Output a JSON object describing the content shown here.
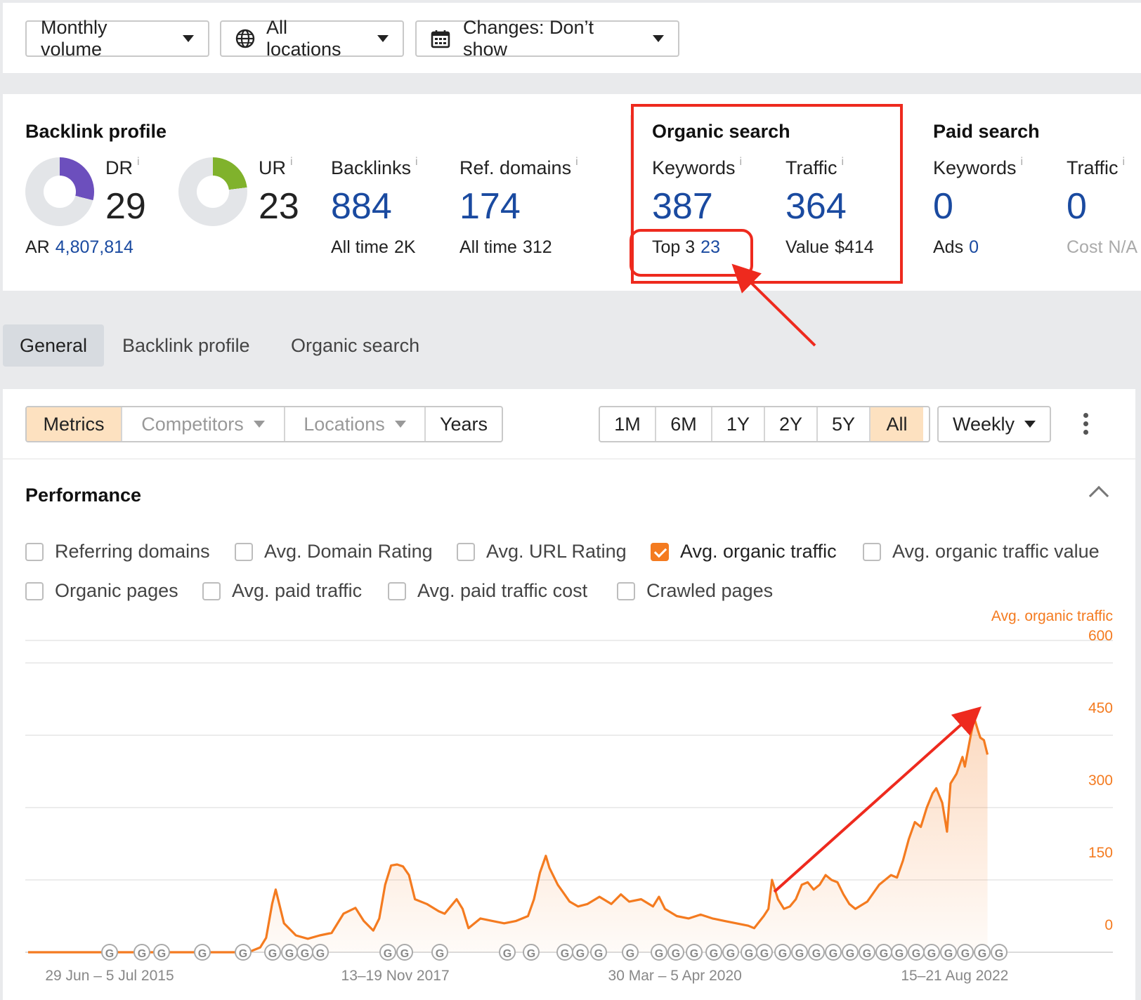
{
  "filters": {
    "volume": "Monthly volume",
    "locations": "All locations",
    "changes": "Changes: Don’t show"
  },
  "backlink_profile": {
    "title": "Backlink profile",
    "dr": {
      "label": "DR",
      "value": "29",
      "fill_fraction": 0.29,
      "color": "#6c4fbd"
    },
    "ur": {
      "label": "UR",
      "value": "23",
      "fill_fraction": 0.23,
      "color": "#80b22c"
    },
    "ar": {
      "label": "AR",
      "value": "4,807,814"
    },
    "backlinks": {
      "label": "Backlinks",
      "value": "884",
      "sub_label": "All time",
      "sub_value": "2K"
    },
    "ref_domains": {
      "label": "Ref. domains",
      "value": "174",
      "sub_label": "All time",
      "sub_value": "312"
    }
  },
  "organic_search": {
    "title": "Organic search",
    "keywords": {
      "label": "Keywords",
      "value": "387",
      "sub_label": "Top 3",
      "sub_value": "23"
    },
    "traffic": {
      "label": "Traffic",
      "value": "364",
      "sub_label": "Value",
      "sub_value": "$414"
    }
  },
  "paid_search": {
    "title": "Paid search",
    "keywords": {
      "label": "Keywords",
      "value": "0",
      "sub_label": "Ads",
      "sub_value": "0"
    },
    "traffic": {
      "label": "Traffic",
      "value": "0",
      "sub_label": "Cost",
      "sub_value": "N/A"
    }
  },
  "info_glyph": "i",
  "tabs": [
    "General",
    "Backlink profile",
    "Organic search"
  ],
  "view_tabs": {
    "metrics": "Metrics",
    "competitors": "Competitors",
    "locations": "Locations",
    "years": "Years"
  },
  "ranges": [
    "1M",
    "6M",
    "1Y",
    "2Y",
    "5Y",
    "All"
  ],
  "active_range": "All",
  "interval": "Weekly",
  "performance": {
    "title": "Performance",
    "checkboxes_row1": [
      {
        "label": "Referring domains",
        "checked": false
      },
      {
        "label": "Avg. Domain Rating",
        "checked": false
      },
      {
        "label": "Avg. URL Rating",
        "checked": false
      },
      {
        "label": "Avg. organic traffic",
        "checked": true
      },
      {
        "label": "Avg. organic traffic value",
        "checked": false
      }
    ],
    "checkboxes_row2": [
      {
        "label": "Organic pages",
        "checked": false
      },
      {
        "label": "Avg. paid traffic",
        "checked": false
      },
      {
        "label": "Avg. paid traffic cost",
        "checked": false
      },
      {
        "label": "Crawled pages",
        "checked": false
      }
    ]
  },
  "chart_data": {
    "type": "area",
    "title": "",
    "series": [
      {
        "name": "Avg. organic traffic",
        "color": "#f47b20"
      }
    ],
    "y_axis_label": "Avg. organic traffic",
    "y_ticks": [
      "0",
      "150",
      "300",
      "450",
      "600"
    ],
    "ylim": [
      0,
      600
    ],
    "x_ticks": [
      "29 Jun – 5 Jul 2015",
      "13–19 Nov 2017",
      "30 Mar – 5 Apr 2020",
      "15–21 Aug 2022"
    ],
    "x_tick_index": [
      0,
      2.4,
      4.75,
      7.1
    ],
    "x_range_years": [
      0,
      8.5
    ],
    "grid": true,
    "points": [
      [
        0,
        0
      ],
      [
        1.85,
        0
      ],
      [
        1.95,
        10
      ],
      [
        2.0,
        30
      ],
      [
        2.05,
        100
      ],
      [
        2.08,
        130
      ],
      [
        2.15,
        60
      ],
      [
        2.25,
        35
      ],
      [
        2.35,
        28
      ],
      [
        2.45,
        35
      ],
      [
        2.55,
        40
      ],
      [
        2.65,
        80
      ],
      [
        2.75,
        92
      ],
      [
        2.82,
        65
      ],
      [
        2.9,
        45
      ],
      [
        2.95,
        70
      ],
      [
        3.0,
        140
      ],
      [
        3.05,
        180
      ],
      [
        3.1,
        182
      ],
      [
        3.15,
        178
      ],
      [
        3.2,
        160
      ],
      [
        3.25,
        110
      ],
      [
        3.35,
        100
      ],
      [
        3.45,
        85
      ],
      [
        3.5,
        80
      ],
      [
        3.6,
        110
      ],
      [
        3.65,
        90
      ],
      [
        3.7,
        50
      ],
      [
        3.8,
        70
      ],
      [
        3.9,
        65
      ],
      [
        4.0,
        60
      ],
      [
        4.1,
        65
      ],
      [
        4.2,
        75
      ],
      [
        4.25,
        110
      ],
      [
        4.3,
        165
      ],
      [
        4.35,
        200
      ],
      [
        4.38,
        175
      ],
      [
        4.45,
        140
      ],
      [
        4.55,
        105
      ],
      [
        4.62,
        95
      ],
      [
        4.7,
        100
      ],
      [
        4.8,
        115
      ],
      [
        4.9,
        100
      ],
      [
        4.98,
        120
      ],
      [
        5.05,
        105
      ],
      [
        5.15,
        110
      ],
      [
        5.25,
        95
      ],
      [
        5.3,
        115
      ],
      [
        5.35,
        90
      ],
      [
        5.45,
        75
      ],
      [
        5.55,
        70
      ],
      [
        5.65,
        78
      ],
      [
        5.75,
        70
      ],
      [
        5.85,
        65
      ],
      [
        5.95,
        60
      ],
      [
        6.05,
        55
      ],
      [
        6.1,
        50
      ],
      [
        6.18,
        75
      ],
      [
        6.22,
        90
      ],
      [
        6.25,
        150
      ],
      [
        6.3,
        110
      ],
      [
        6.35,
        90
      ],
      [
        6.4,
        95
      ],
      [
        6.45,
        110
      ],
      [
        6.5,
        140
      ],
      [
        6.55,
        145
      ],
      [
        6.6,
        130
      ],
      [
        6.65,
        140
      ],
      [
        6.7,
        160
      ],
      [
        6.75,
        150
      ],
      [
        6.8,
        145
      ],
      [
        6.85,
        120
      ],
      [
        6.9,
        100
      ],
      [
        6.95,
        90
      ],
      [
        7.05,
        105
      ],
      [
        7.15,
        140
      ],
      [
        7.25,
        160
      ],
      [
        7.3,
        155
      ],
      [
        7.35,
        190
      ],
      [
        7.4,
        235
      ],
      [
        7.45,
        270
      ],
      [
        7.5,
        260
      ],
      [
        7.55,
        300
      ],
      [
        7.6,
        330
      ],
      [
        7.63,
        340
      ],
      [
        7.68,
        310
      ],
      [
        7.72,
        250
      ],
      [
        7.75,
        350
      ],
      [
        7.8,
        370
      ],
      [
        7.85,
        405
      ],
      [
        7.87,
        385
      ],
      [
        7.92,
        450
      ],
      [
        7.95,
        485
      ],
      [
        7.98,
        460
      ],
      [
        8.0,
        445
      ],
      [
        8.03,
        440
      ],
      [
        8.06,
        410
      ]
    ]
  }
}
